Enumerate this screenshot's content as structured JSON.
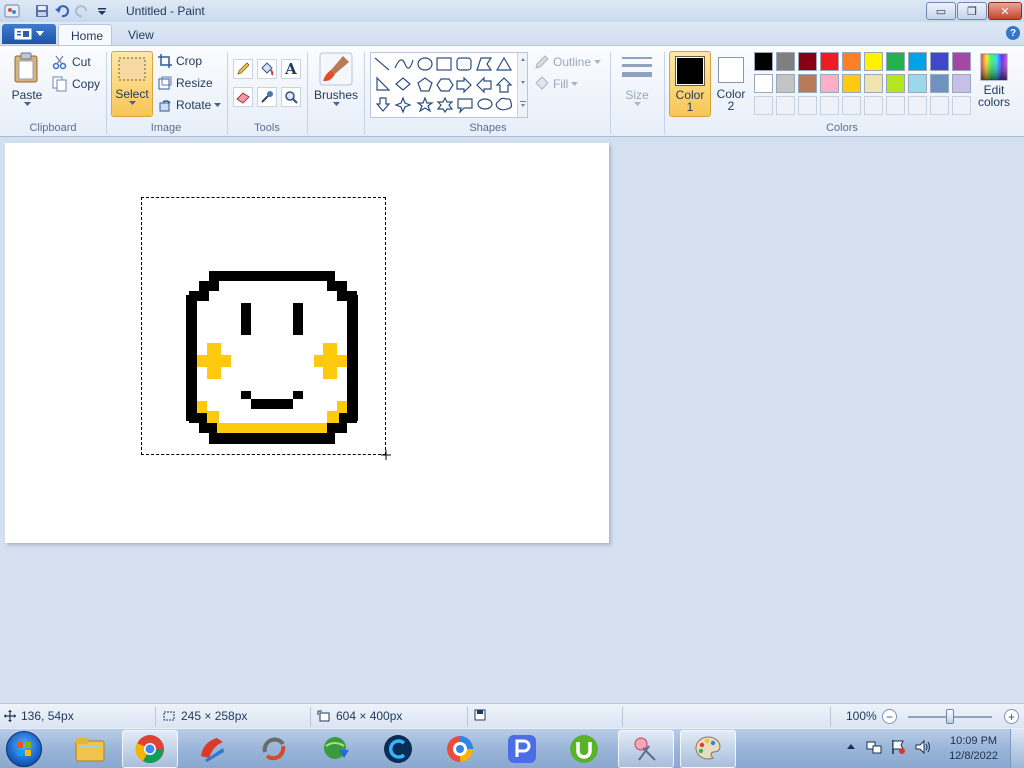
{
  "window": {
    "title": "Untitled - Paint",
    "controls": {
      "minimize": "▭",
      "maximize": "❐",
      "close": "✕"
    }
  },
  "tabs": {
    "home": "Home",
    "view": "View"
  },
  "help": "?",
  "clipboard": {
    "paste": "Paste",
    "cut": "Cut",
    "copy": "Copy",
    "label": "Clipboard"
  },
  "image": {
    "select": "Select",
    "crop": "Crop",
    "resize": "Resize",
    "rotate": "Rotate",
    "label": "Image"
  },
  "tools": {
    "label": "Tools",
    "text_tool": "A"
  },
  "brushes": {
    "label": "Brushes"
  },
  "shapes": {
    "outline": "Outline",
    "fill": "Fill",
    "label": "Shapes"
  },
  "size": {
    "label": "Size"
  },
  "colors": {
    "color1_label": "Color 1",
    "color1_line1": "Color",
    "color1_line2": "1",
    "color2_line1": "Color",
    "color2_line2": "2",
    "color1_value": "#000000",
    "color2_value": "#ffffff",
    "edit_line1": "Edit",
    "edit_line2": "colors",
    "label": "Colors",
    "palette_row1": [
      "#000000",
      "#7f7f7f",
      "#880015",
      "#ed1c24",
      "#ff7f27",
      "#fff200",
      "#22b14c",
      "#00a2e8",
      "#3f48cc",
      "#a349a4"
    ],
    "palette_row2": [
      "#ffffff",
      "#c3c3c3",
      "#b97a57",
      "#ffaec9",
      "#ffc90e",
      "#efe4b0",
      "#b5e61d",
      "#99d9ea",
      "#7092be",
      "#c8bfe7"
    ]
  },
  "status": {
    "cursor_pos": "136, 54px",
    "selection_size": "245 × 258px",
    "canvas_size": "604 × 400px",
    "zoom": "100%",
    "zoom_level": 1.0
  },
  "clock": {
    "time": "10:09 PM",
    "date": "12/8/2022"
  },
  "taskbar_apps": [
    "file-explorer",
    "chrome",
    "ccleaner",
    "sync-app",
    "internet-download-manager",
    "ccleaner-cloud",
    "browser",
    "p-app",
    "utorrent",
    "snipping-tool",
    "paint"
  ]
}
